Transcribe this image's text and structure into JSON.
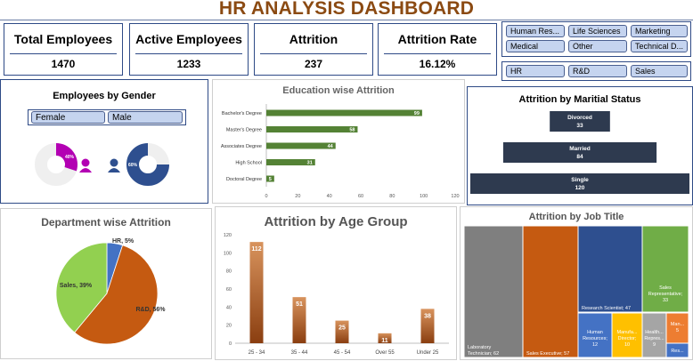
{
  "header": {
    "title": "HR ANALYSIS DASHBOARD"
  },
  "kpis": [
    {
      "label": "Total Employees",
      "value": "1470"
    },
    {
      "label": "Active Employees",
      "value": "1233"
    },
    {
      "label": "Attrition",
      "value": "237"
    },
    {
      "label": "Attrition Rate",
      "value": "16.12%"
    }
  ],
  "education_slicer": {
    "options": [
      "Human Res...",
      "Life Sciences",
      "Marketing",
      "Medical",
      "Other",
      "Technical D..."
    ]
  },
  "department_slicer": {
    "options": [
      "HR",
      "R&D",
      "Sales"
    ]
  },
  "gender_panel": {
    "title": "Employees by Gender",
    "slicer": [
      "Female",
      "Male"
    ],
    "female_pct_label": "40%",
    "male_pct_label": "60%",
    "female_color": "#b300b3",
    "male_color": "#2e4f8f"
  },
  "education_chart": {
    "title": "Education wise Attrition",
    "bar_color": "#548235",
    "ticks": [
      "0",
      "20",
      "40",
      "60",
      "80",
      "100",
      "120"
    ]
  },
  "marital_chart": {
    "title": "Attrition by Maritial Status",
    "bar_color": "#2e3a4f"
  },
  "department_chart": {
    "title": "Department wise Attrition"
  },
  "age_chart": {
    "title": "Attrition by Age Group",
    "ticks": [
      "0",
      "20",
      "40",
      "60",
      "80",
      "100",
      "120"
    ]
  },
  "job_chart": {
    "title": "Attrition by Job Title"
  },
  "chart_data": [
    {
      "type": "bar",
      "orientation": "horizontal",
      "title": "Education wise Attrition",
      "categories": [
        "Bachelor's Degree",
        "Master's Degree",
        "Associates Degree",
        "High School",
        "Doctoral Degree"
      ],
      "values": [
        99,
        58,
        44,
        31,
        5
      ],
      "xlim": [
        0,
        120
      ]
    },
    {
      "type": "bar",
      "orientation": "horizontal",
      "title": "Attrition by Maritial Status",
      "categories": [
        "Divorced",
        "Married",
        "Single"
      ],
      "values": [
        33,
        84,
        120
      ]
    },
    {
      "type": "pie",
      "title": "Department wise Attrition",
      "categories": [
        "HR",
        "R&D",
        "Sales"
      ],
      "values": [
        5,
        56,
        39
      ],
      "labels": [
        "HR, 5%",
        "R&D, 56%",
        "Sales, 39%"
      ],
      "colors": [
        "#4472c4",
        "#c55a11",
        "#92d050"
      ]
    },
    {
      "type": "bar",
      "title": "Attrition by Age Group",
      "categories": [
        "25 - 34",
        "35 - 44",
        "45 - 54",
        "Over 55",
        "Under 25"
      ],
      "values": [
        112,
        51,
        25,
        11,
        38
      ],
      "ylim": [
        0,
        120
      ]
    },
    {
      "type": "treemap",
      "title": "Attrition by Job Title",
      "labels": [
        "Laboratory Technician; 62",
        "Sales Executive; 57",
        "Research Scientist; 47",
        "Sales Representative; 33",
        "Human Resources; 12",
        "Manufa... Director; 10",
        "Health... Repres...; 9",
        "Man... 5",
        "Res... 2"
      ],
      "values": [
        62,
        57,
        47,
        33,
        12,
        10,
        9,
        5,
        2
      ],
      "colors": [
        "#7f7f7f",
        "#c55a11",
        "#2e4f8f",
        "#70ad47",
        "#4472c4",
        "#ffc000",
        "#a5a5a5",
        "#ed7d31",
        "#4472c4"
      ]
    }
  ]
}
